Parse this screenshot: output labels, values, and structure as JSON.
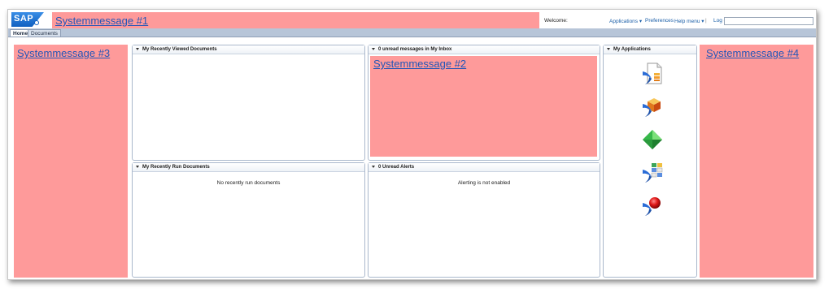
{
  "header": {
    "logo_text": "SAP",
    "system_message_1": "Systemmessage #1",
    "welcome": "Welcome:",
    "applications_label": "Applications",
    "preferences_label": "Preferences",
    "help_menu_label": "Help menu",
    "separator": "|",
    "logoff_label": "Log off",
    "search_value": ""
  },
  "tabs": [
    {
      "label": "Home",
      "active": true
    },
    {
      "label": "Documents",
      "active": false
    }
  ],
  "left": {
    "system_message_3": "Systemmessage #3"
  },
  "right": {
    "system_message_4": "Systemmessage #4"
  },
  "panels": {
    "recently_viewed": {
      "title": "My Recently Viewed Documents"
    },
    "recently_run": {
      "title": "My Recently Run Documents",
      "empty_text": "No recently run documents"
    },
    "inbox": {
      "title": "0 unread messages in My Inbox",
      "system_message_2": "Systemmessage #2"
    },
    "alerts": {
      "title": "0 Unread Alerts",
      "empty_text": "Alerting is not enabled"
    },
    "applications": {
      "title": "My Applications",
      "icons": [
        "document-report-icon",
        "cube-app-icon",
        "green-diamond-icon",
        "grid-app-icon",
        "red-sphere-icon"
      ]
    }
  },
  "colors": {
    "system_message_bg": "#fe9a9a",
    "system_message_text": "#2356b8",
    "nav_bar": "#b7c5d8",
    "link": "#1b5fa8"
  }
}
